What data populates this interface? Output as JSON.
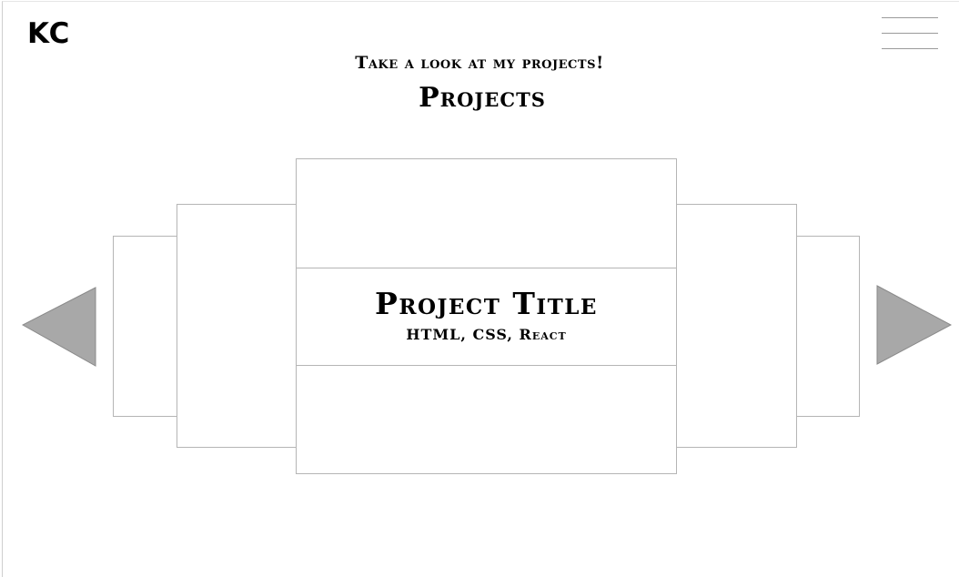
{
  "header": {
    "logo_text": "KC",
    "menu_icon": "hamburger-menu-icon"
  },
  "hero": {
    "tagline": "Take a look at my projects!",
    "heading": "Projects"
  },
  "carousel": {
    "current": {
      "title": "Project Title",
      "tech": "HTML, CSS, React"
    },
    "prev_icon": "triangle-left-icon",
    "next_icon": "triangle-right-icon"
  },
  "colors": {
    "arrow_fill": "#a8a8a8",
    "card_border": "#b5b5b5",
    "background": "#ffffff"
  }
}
